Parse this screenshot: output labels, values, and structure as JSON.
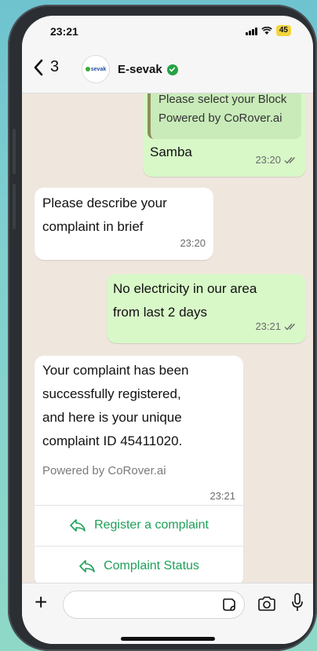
{
  "status": {
    "time": "23:21",
    "battery": "45"
  },
  "header": {
    "back_count": "3",
    "contact_name": "E-sevak",
    "avatar_text": "sevak"
  },
  "messages": [
    {
      "quote_line1": "Please select your Block",
      "quote_line2": "Powered by CoRover.ai",
      "text": "Samba",
      "time": "23:20",
      "direction": "outgoing"
    },
    {
      "line1": "Please describe your",
      "line2": "complaint in brief",
      "time": "23:20",
      "direction": "incoming"
    },
    {
      "line1": "No electricity in our area",
      "line2": "from last 2 days",
      "time": "23:21",
      "direction": "outgoing"
    },
    {
      "line1": "Your complaint has been",
      "line2": "successfully registered,",
      "line3": "and here is your unique",
      "line4": "complaint ID 45411020.",
      "footer": "Powered by CoRover.ai",
      "time": "23:21",
      "direction": "incoming",
      "buttons": [
        "Register a complaint",
        "Complaint Status"
      ]
    }
  ],
  "colors": {
    "outgoing_bubble": "#d8f8c8",
    "incoming_bubble": "#ffffff",
    "accent": "#1ea05a",
    "chat_bg": "#efe7de"
  }
}
